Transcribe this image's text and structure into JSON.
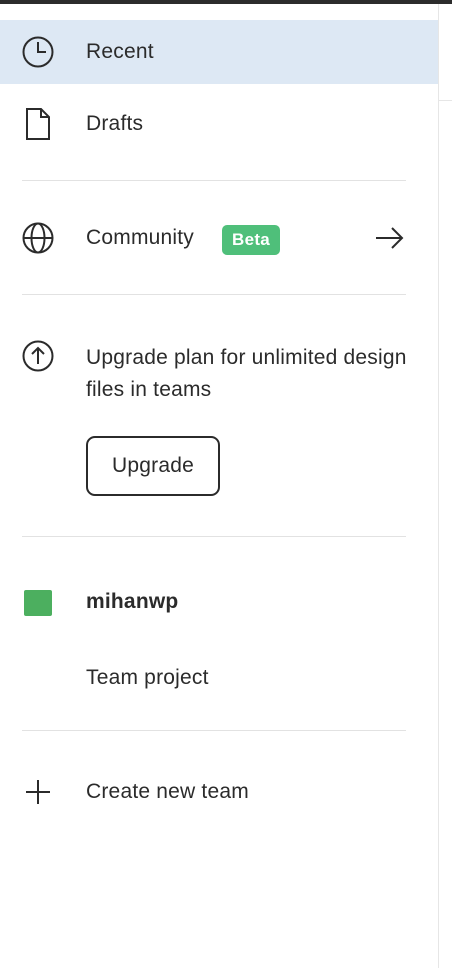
{
  "nav": {
    "recent_label": "Recent",
    "drafts_label": "Drafts"
  },
  "community": {
    "label": "Community",
    "badge": "Beta"
  },
  "upgrade": {
    "message": "Upgrade plan for unlimited design files in teams",
    "button_label": "Upgrade"
  },
  "team": {
    "name": "mihanwp",
    "swatch_color": "#4caf5f",
    "project_label": "Team project"
  },
  "create_team_label": "Create new team",
  "colors": {
    "selected_row": "#dde8f4",
    "beta_badge": "#4fbf7a",
    "top_bar": "#2c2c2c"
  },
  "icons": {
    "recent": "clock-icon",
    "drafts": "document-icon",
    "community": "globe-icon",
    "community_link": "arrow-right-icon",
    "upgrade": "arrow-up-circle-icon",
    "create_team": "plus-icon"
  }
}
